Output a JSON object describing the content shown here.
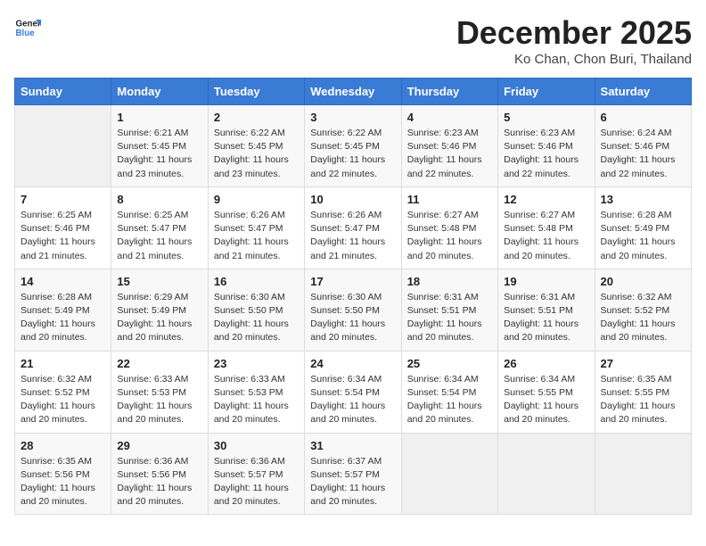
{
  "logo": {
    "line1": "General",
    "line2": "Blue"
  },
  "title": "December 2025",
  "location": "Ko Chan, Chon Buri, Thailand",
  "weekdays": [
    "Sunday",
    "Monday",
    "Tuesday",
    "Wednesday",
    "Thursday",
    "Friday",
    "Saturday"
  ],
  "weeks": [
    [
      {
        "day": "",
        "info": ""
      },
      {
        "day": "1",
        "info": "Sunrise: 6:21 AM\nSunset: 5:45 PM\nDaylight: 11 hours\nand 23 minutes."
      },
      {
        "day": "2",
        "info": "Sunrise: 6:22 AM\nSunset: 5:45 PM\nDaylight: 11 hours\nand 23 minutes."
      },
      {
        "day": "3",
        "info": "Sunrise: 6:22 AM\nSunset: 5:45 PM\nDaylight: 11 hours\nand 22 minutes."
      },
      {
        "day": "4",
        "info": "Sunrise: 6:23 AM\nSunset: 5:46 PM\nDaylight: 11 hours\nand 22 minutes."
      },
      {
        "day": "5",
        "info": "Sunrise: 6:23 AM\nSunset: 5:46 PM\nDaylight: 11 hours\nand 22 minutes."
      },
      {
        "day": "6",
        "info": "Sunrise: 6:24 AM\nSunset: 5:46 PM\nDaylight: 11 hours\nand 22 minutes."
      }
    ],
    [
      {
        "day": "7",
        "info": "Sunrise: 6:25 AM\nSunset: 5:46 PM\nDaylight: 11 hours\nand 21 minutes."
      },
      {
        "day": "8",
        "info": "Sunrise: 6:25 AM\nSunset: 5:47 PM\nDaylight: 11 hours\nand 21 minutes."
      },
      {
        "day": "9",
        "info": "Sunrise: 6:26 AM\nSunset: 5:47 PM\nDaylight: 11 hours\nand 21 minutes."
      },
      {
        "day": "10",
        "info": "Sunrise: 6:26 AM\nSunset: 5:47 PM\nDaylight: 11 hours\nand 21 minutes."
      },
      {
        "day": "11",
        "info": "Sunrise: 6:27 AM\nSunset: 5:48 PM\nDaylight: 11 hours\nand 20 minutes."
      },
      {
        "day": "12",
        "info": "Sunrise: 6:27 AM\nSunset: 5:48 PM\nDaylight: 11 hours\nand 20 minutes."
      },
      {
        "day": "13",
        "info": "Sunrise: 6:28 AM\nSunset: 5:49 PM\nDaylight: 11 hours\nand 20 minutes."
      }
    ],
    [
      {
        "day": "14",
        "info": "Sunrise: 6:28 AM\nSunset: 5:49 PM\nDaylight: 11 hours\nand 20 minutes."
      },
      {
        "day": "15",
        "info": "Sunrise: 6:29 AM\nSunset: 5:49 PM\nDaylight: 11 hours\nand 20 minutes."
      },
      {
        "day": "16",
        "info": "Sunrise: 6:30 AM\nSunset: 5:50 PM\nDaylight: 11 hours\nand 20 minutes."
      },
      {
        "day": "17",
        "info": "Sunrise: 6:30 AM\nSunset: 5:50 PM\nDaylight: 11 hours\nand 20 minutes."
      },
      {
        "day": "18",
        "info": "Sunrise: 6:31 AM\nSunset: 5:51 PM\nDaylight: 11 hours\nand 20 minutes."
      },
      {
        "day": "19",
        "info": "Sunrise: 6:31 AM\nSunset: 5:51 PM\nDaylight: 11 hours\nand 20 minutes."
      },
      {
        "day": "20",
        "info": "Sunrise: 6:32 AM\nSunset: 5:52 PM\nDaylight: 11 hours\nand 20 minutes."
      }
    ],
    [
      {
        "day": "21",
        "info": "Sunrise: 6:32 AM\nSunset: 5:52 PM\nDaylight: 11 hours\nand 20 minutes."
      },
      {
        "day": "22",
        "info": "Sunrise: 6:33 AM\nSunset: 5:53 PM\nDaylight: 11 hours\nand 20 minutes."
      },
      {
        "day": "23",
        "info": "Sunrise: 6:33 AM\nSunset: 5:53 PM\nDaylight: 11 hours\nand 20 minutes."
      },
      {
        "day": "24",
        "info": "Sunrise: 6:34 AM\nSunset: 5:54 PM\nDaylight: 11 hours\nand 20 minutes."
      },
      {
        "day": "25",
        "info": "Sunrise: 6:34 AM\nSunset: 5:54 PM\nDaylight: 11 hours\nand 20 minutes."
      },
      {
        "day": "26",
        "info": "Sunrise: 6:34 AM\nSunset: 5:55 PM\nDaylight: 11 hours\nand 20 minutes."
      },
      {
        "day": "27",
        "info": "Sunrise: 6:35 AM\nSunset: 5:55 PM\nDaylight: 11 hours\nand 20 minutes."
      }
    ],
    [
      {
        "day": "28",
        "info": "Sunrise: 6:35 AM\nSunset: 5:56 PM\nDaylight: 11 hours\nand 20 minutes."
      },
      {
        "day": "29",
        "info": "Sunrise: 6:36 AM\nSunset: 5:56 PM\nDaylight: 11 hours\nand 20 minutes."
      },
      {
        "day": "30",
        "info": "Sunrise: 6:36 AM\nSunset: 5:57 PM\nDaylight: 11 hours\nand 20 minutes."
      },
      {
        "day": "31",
        "info": "Sunrise: 6:37 AM\nSunset: 5:57 PM\nDaylight: 11 hours\nand 20 minutes."
      },
      {
        "day": "",
        "info": ""
      },
      {
        "day": "",
        "info": ""
      },
      {
        "day": "",
        "info": ""
      }
    ]
  ]
}
